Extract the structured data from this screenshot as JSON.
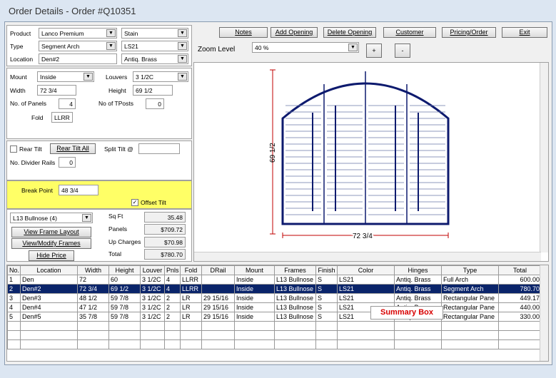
{
  "window_title": "Order Details - Order #Q10351",
  "product": {
    "product_label": "Product",
    "product_value": "Lanco Premium",
    "finish_value": "Stain",
    "type_label": "Type",
    "type_value": "Segment Arch",
    "color_value": "LS21",
    "location_label": "Location",
    "location_value": "Den#2",
    "hinge_value": "Antiq. Brass"
  },
  "dims": {
    "mount_label": "Mount",
    "mount_value": "Inside",
    "louvers_label": "Louvers",
    "louvers_value": "3 1/2C",
    "width_label": "Width",
    "width_value": "72 3/4",
    "height_label": "Height",
    "height_value": "69 1/2",
    "panels_label": "No. of Panels",
    "panels_value": "4",
    "tposts_label": "No of TPosts",
    "tposts_value": "0",
    "fold_label": "Fold",
    "fold_value": "LLRR"
  },
  "tilt": {
    "rear_tilt_label": "Rear Tilt",
    "rear_tilt_all_label": "Rear Tilt All",
    "split_tilt_label": "Split Tilt @",
    "split_tilt_value": "",
    "divider_label": "No. Divider Rails",
    "divider_value": "0"
  },
  "breakpoint": {
    "label": "Break Point",
    "value": "48 3/4",
    "offset_tilt_label": "Offset Tilt",
    "offset_checked": "✓"
  },
  "frames": {
    "frame_value": "L13 Bullnose (4)",
    "view_layout_label": "View Frame Layout",
    "view_modify_label": "View/Modify Frames",
    "hide_price_label": "Hide Price",
    "sqft_label": "Sq Ft",
    "sqft_value": "35.48",
    "panels_label": "Panels",
    "panels_value": "$709.72",
    "upcharges_label": "Up Charges",
    "upcharges_value": "$70.98",
    "total_label": "Total",
    "total_value": "$780.70"
  },
  "toolbar": {
    "notes": "Notes",
    "add_opening": "Add Opening",
    "delete_opening": "Delete Opening",
    "customer": "Customer",
    "pricing": "Pricing/Order",
    "exit": "Exit"
  },
  "zoom": {
    "label": "Zoom Level",
    "value": "40 %",
    "plus": "+",
    "minus": "-"
  },
  "drawing": {
    "height_dim": "69 1/2",
    "width_dim": "72 3/4"
  },
  "table": {
    "headers": [
      "No.",
      "Location",
      "Width",
      "Height",
      "Louver",
      "Pnls",
      "Fold",
      "DRail",
      "Mount",
      "Frames",
      "Finish",
      "Color",
      "Hinges",
      "Type",
      "Total"
    ],
    "rows": [
      [
        "1",
        "Den",
        "72",
        "60",
        "3 1/2C",
        "4",
        "LLRR",
        "",
        "Inside",
        "L13 Bullnose",
        "S",
        "LS21",
        "Antiq. Brass",
        "Full Arch",
        "600.00"
      ],
      [
        "2",
        "Den#2",
        "72 3/4",
        "69 1/2",
        "3 1/2C",
        "4",
        "LLRR",
        "",
        "Inside",
        "L13 Bullnose",
        "S",
        "LS21",
        "Antiq. Brass",
        "Segment Arch",
        "780.70"
      ],
      [
        "3",
        "Den#3",
        "48 1/2",
        "59 7/8",
        "3 1/2C",
        "2",
        "LR",
        "29 15/16",
        "Inside",
        "L13 Bullnose",
        "S",
        "LS21",
        "Antiq. Brass",
        "Rectangular Pane",
        "449.17"
      ],
      [
        "4",
        "Den#4",
        "47 1/2",
        "59 7/8",
        "3 1/2C",
        "2",
        "LR",
        "29 15/16",
        "Inside",
        "L13 Bullnose",
        "S",
        "LS21",
        "Antiq. Brass",
        "Rectangular Pane",
        "440.00"
      ],
      [
        "5",
        "Den#5",
        "35 7/8",
        "59 7/8",
        "3 1/2C",
        "2",
        "LR",
        "29 15/16",
        "Inside",
        "L13 Bullnose",
        "S",
        "LS21",
        "Antiq. Brass",
        "Rectangular Pane",
        "330.00"
      ]
    ]
  },
  "summary_label": "Summary Box",
  "colors": {
    "accent": "#0a246a",
    "highlight": "#ffff66",
    "summary": "#d80000",
    "drawing": "#0d1a6e",
    "dimension": "#c00000"
  }
}
